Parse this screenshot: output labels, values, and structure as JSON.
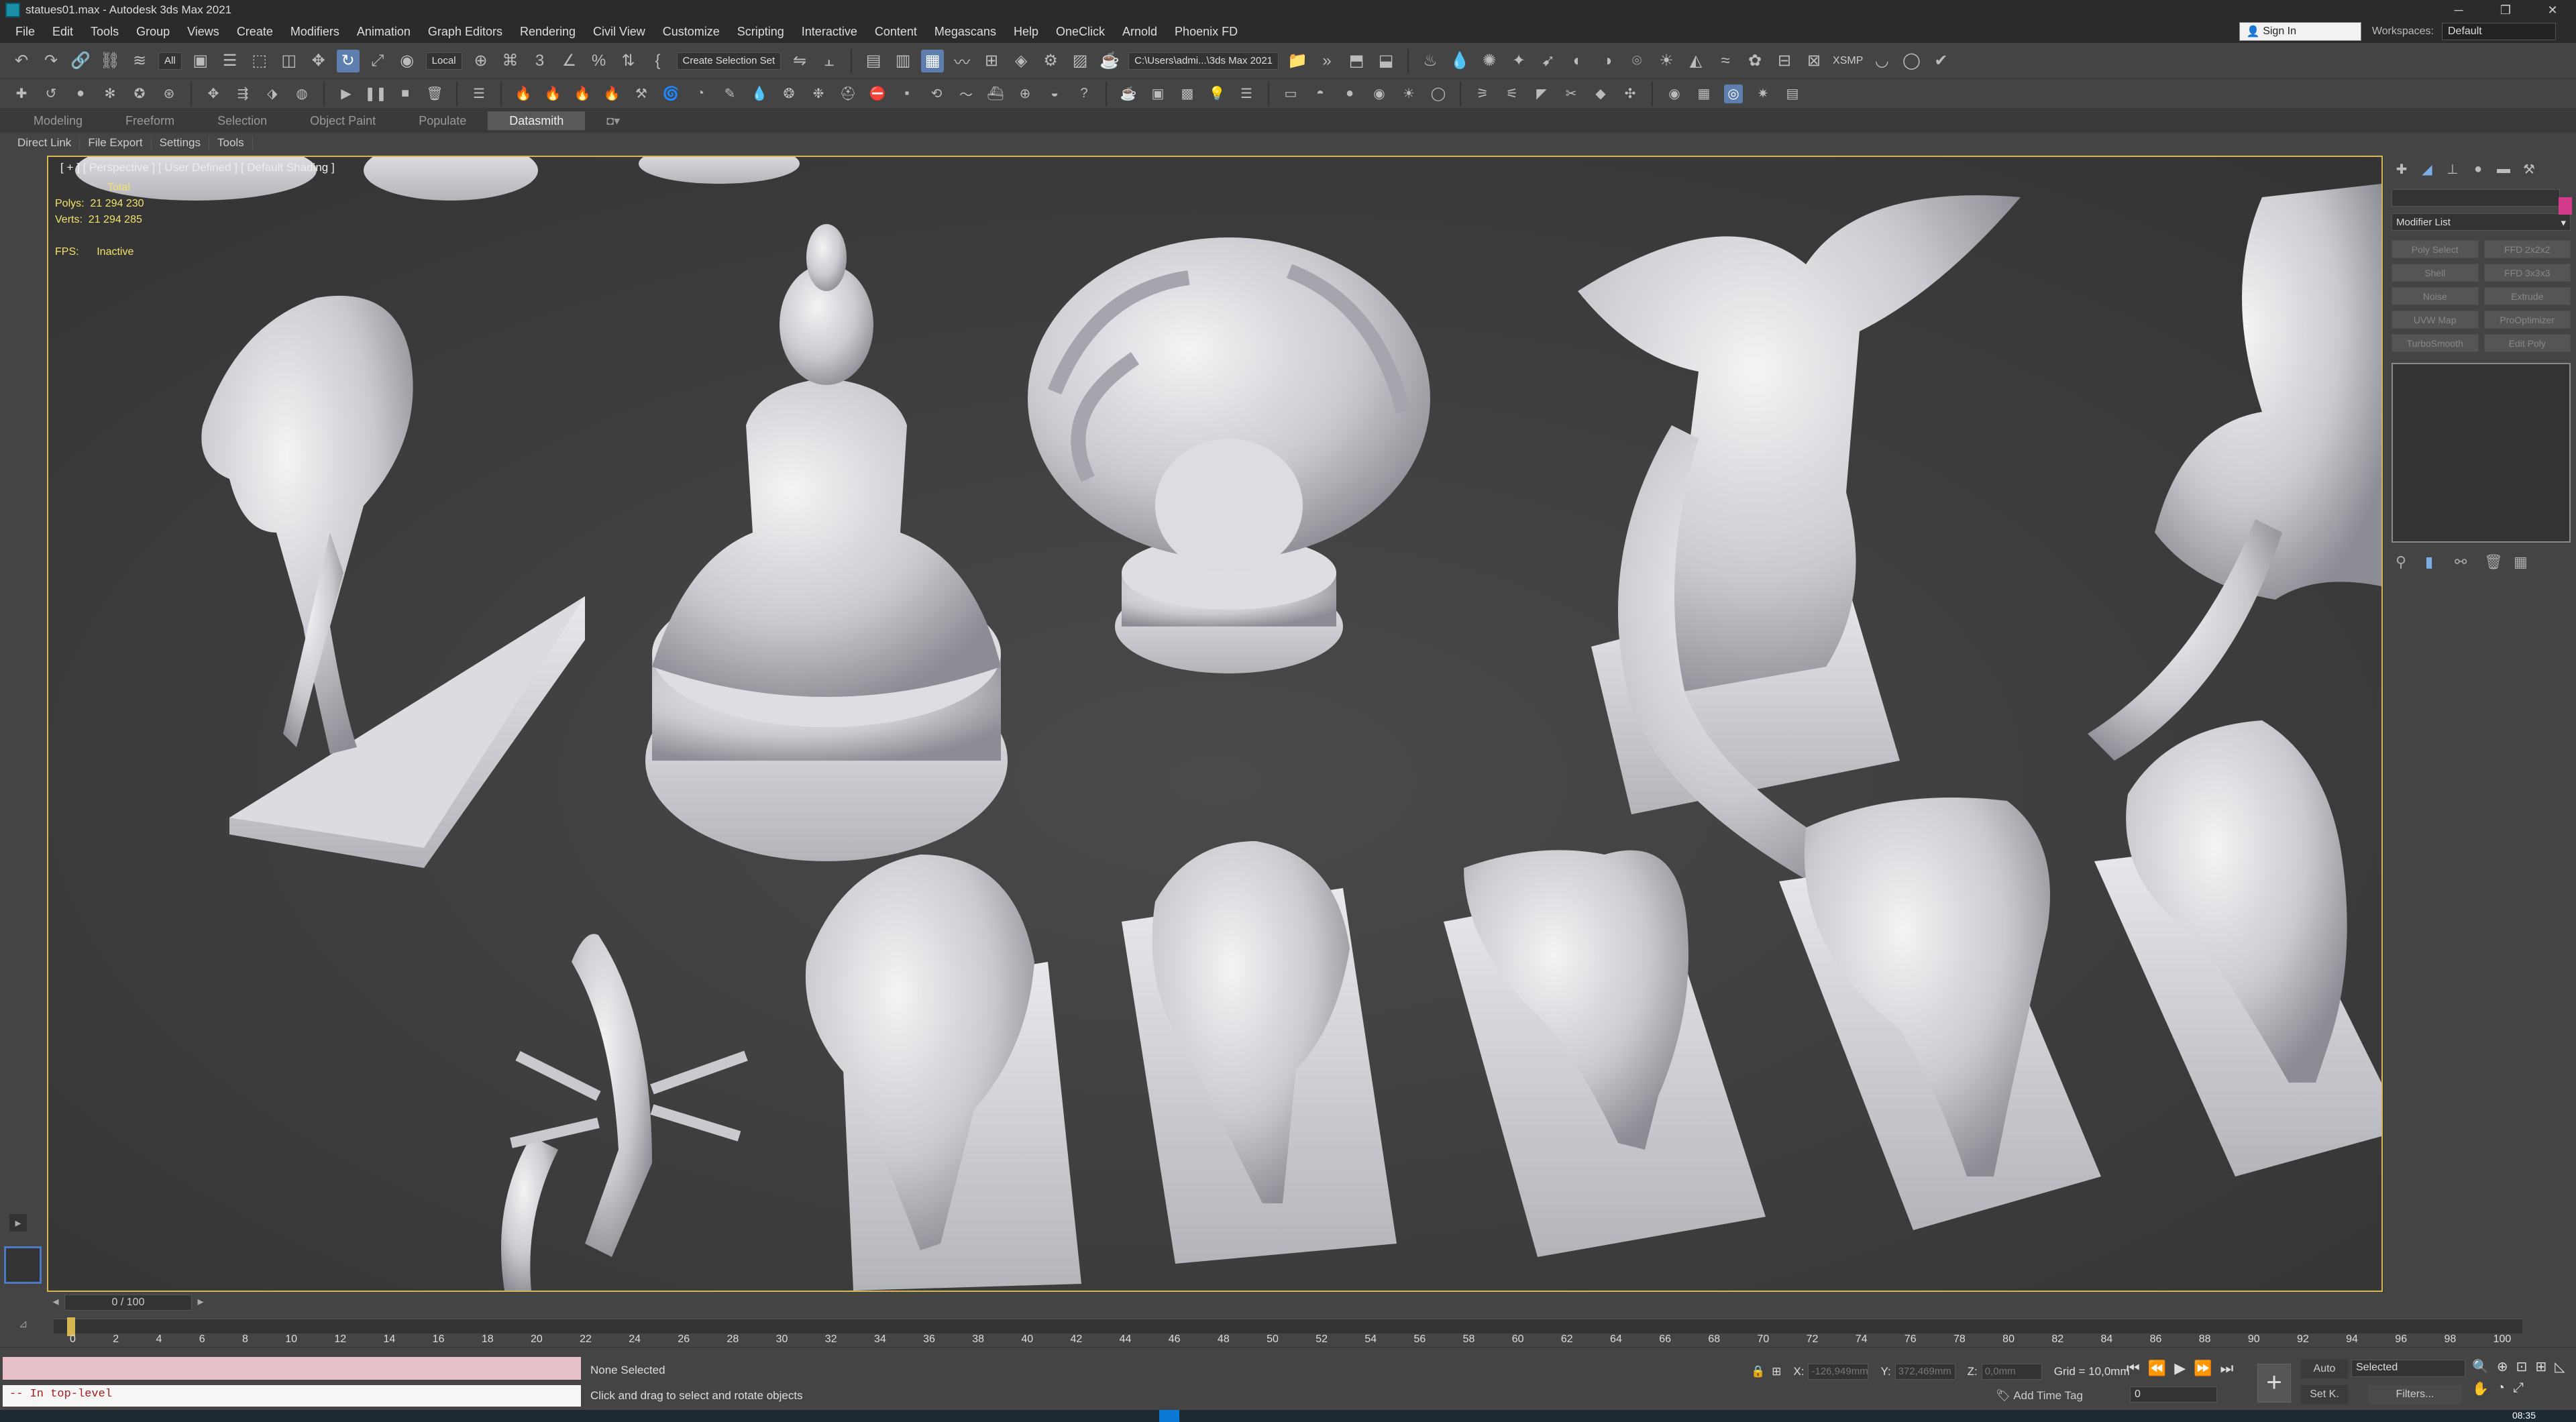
{
  "window": {
    "title": "statues01.max - Autodesk 3ds Max 2021",
    "min": "─",
    "restore": "❐",
    "close": "✕"
  },
  "menu": {
    "items": [
      "File",
      "Edit",
      "Tools",
      "Group",
      "Views",
      "Create",
      "Modifiers",
      "Animation",
      "Graph Editors",
      "Rendering",
      "Civil View",
      "Customize",
      "Scripting",
      "Interactive",
      "Content",
      "Megascans",
      "Help",
      "OneClick",
      "Arnold",
      "Phoenix FD"
    ],
    "sign_in": "Sign In",
    "workspaces_label": "Workspaces:",
    "workspaces_value": "Default"
  },
  "toolbar": {
    "filter_value": "All",
    "coord_value": "Local",
    "selection_set": "Create Selection Set",
    "project_path": "C:\\Users\\admi...\\3ds Max 2021",
    "xsmp_label": "XSMP"
  },
  "ribbon": {
    "tabs": [
      "Modeling",
      "Freeform",
      "Selection",
      "Object Paint",
      "Populate",
      "Datasmith"
    ],
    "active": "Datasmith"
  },
  "subtabs": [
    "Direct Link",
    "File Export",
    "Settings",
    "Tools"
  ],
  "viewport": {
    "label": "[ + ] [ Perspective ] [ User Defined ] [ Default Shading ]",
    "stats_total": "Total",
    "polys_label": "Polys:",
    "polys_value": "21 294 230",
    "verts_label": "Verts:",
    "verts_value": "21 294 285",
    "fps_label": "FPS:",
    "fps_value": "Inactive"
  },
  "command_panel": {
    "modifier_list": "Modifier List",
    "buttons": [
      "Poly Select",
      "FFD 2x2x2",
      "Shell",
      "FFD 3x3x3",
      "Noise",
      "Extrude",
      "UVW Map",
      "ProOptimizer",
      "TurboSmooth",
      "Edit Poly"
    ]
  },
  "timeline": {
    "slider": "0 / 100",
    "ticks": [
      "0",
      "2",
      "4",
      "6",
      "8",
      "10",
      "12",
      "14",
      "16",
      "18",
      "20",
      "22",
      "24",
      "26",
      "28",
      "30",
      "32",
      "34",
      "36",
      "38",
      "40",
      "42",
      "44",
      "46",
      "48",
      "50",
      "52",
      "54",
      "56",
      "58",
      "60",
      "62",
      "64",
      "66",
      "68",
      "70",
      "72",
      "74",
      "76",
      "78",
      "80",
      "82",
      "84",
      "86",
      "88",
      "90",
      "92",
      "94",
      "96",
      "98",
      "100"
    ]
  },
  "status": {
    "listener": "-- In top-level",
    "selection": "None Selected",
    "prompt": "Click and drag to select and rotate objects",
    "x_label": "X:",
    "x_value": "-126,949mm",
    "y_label": "Y:",
    "y_value": "372,469mm",
    "z_label": "Z:",
    "z_value": "0,0mm",
    "grid": "Grid = 10,0mm",
    "add_time_tag": "Add Time Tag",
    "frame": "0",
    "auto": "Auto",
    "set_key": "Set K.",
    "selected_dropdown": "Selected",
    "filters": "Filters..."
  },
  "taskbar": {
    "time": "08:35"
  },
  "colors": {
    "accent": "#5d7eae",
    "viewport_border": "#d6b553",
    "stats": "#f2e26c",
    "listener_text": "#a21d1d"
  }
}
